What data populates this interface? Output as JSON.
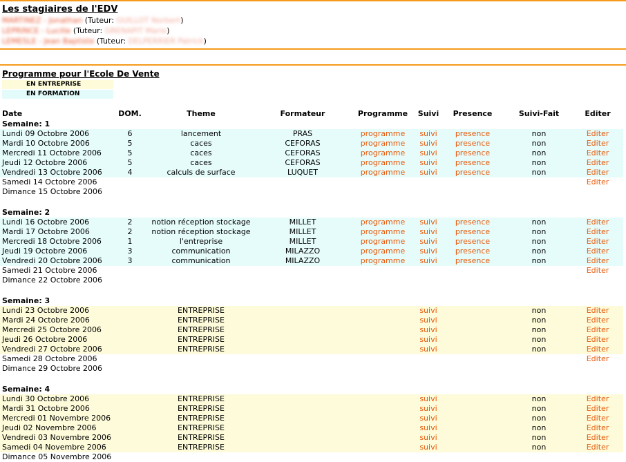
{
  "title": "Les stagiaires de l'EDV",
  "trainees": [
    {
      "name": "MARTINEZ - Jonathan",
      "tutor_label": "(Tuteur:",
      "tutor": "GUILLOT Norbert",
      "close": ")"
    },
    {
      "name": "LEPRINCE - Lucille",
      "tutor_label": "(Tuteur:",
      "tutor": "GRENAPIT Marie",
      "close": ")"
    },
    {
      "name": "LEMESLE - Jean Baptiste",
      "tutor_label": "(Tuteur:",
      "tutor": "DELPERRIER Patrick",
      "close": ")"
    }
  ],
  "programme_title": "Programme pour l'Ecole De Vente",
  "legend": {
    "entreprise": "EN ENTREPRISE",
    "formation": "EN FORMATION"
  },
  "columns": {
    "date": "Date",
    "dom": "DOM.",
    "theme": "Theme",
    "formateur": "Formateur",
    "programme": "Programme",
    "suivi": "Suivi",
    "presence": "Presence",
    "suivi_fait": "Suivi-Fait",
    "editer": "Editer"
  },
  "weeks": [
    {
      "label": "Semaine: 1",
      "days": [
        {
          "date": "Lundi 09 Octobre 2006",
          "type": "form",
          "dom": "6",
          "theme": "lancement",
          "formateur": "PRAS",
          "programme": "programme",
          "suivi": "suivi",
          "presence": "presence",
          "suivi_fait": "non",
          "editer": "Editer"
        },
        {
          "date": "Mardi 10 Octobre 2006",
          "type": "form",
          "dom": "5",
          "theme": "caces",
          "formateur": "CEFORAS",
          "programme": "programme",
          "suivi": "suivi",
          "presence": "presence",
          "suivi_fait": "non",
          "editer": "Editer"
        },
        {
          "date": "Mercredi 11 Octobre 2006",
          "type": "form",
          "dom": "5",
          "theme": "caces",
          "formateur": "CEFORAS",
          "programme": "programme",
          "suivi": "suivi",
          "presence": "presence",
          "suivi_fait": "non",
          "editer": "Editer"
        },
        {
          "date": "Jeudi 12 Octobre 2006",
          "type": "form",
          "dom": "5",
          "theme": "caces",
          "formateur": "CEFORAS",
          "programme": "programme",
          "suivi": "suivi",
          "presence": "presence",
          "suivi_fait": "non",
          "editer": "Editer"
        },
        {
          "date": "Vendredi 13 Octobre 2006",
          "type": "form",
          "dom": "4",
          "theme": "calculs de surface",
          "formateur": "LUQUET",
          "programme": "programme",
          "suivi": "suivi",
          "presence": "presence",
          "suivi_fait": "non",
          "editer": "Editer"
        },
        {
          "date": "Samedi 14 Octobre 2006",
          "type": "none",
          "editer": "Editer"
        },
        {
          "date": "Dimance 15 Octobre 2006",
          "type": "none"
        }
      ]
    },
    {
      "label": "Semaine: 2",
      "days": [
        {
          "date": "Lundi 16 Octobre 2006",
          "type": "form",
          "dom": "2",
          "theme": "notion réception stockage",
          "formateur": "MILLET",
          "programme": "programme",
          "suivi": "suivi",
          "presence": "presence",
          "suivi_fait": "non",
          "editer": "Editer"
        },
        {
          "date": "Mardi 17 Octobre 2006",
          "type": "form",
          "dom": "2",
          "theme": "notion réception stockage",
          "formateur": "MILLET",
          "programme": "programme",
          "suivi": "suivi",
          "presence": "presence",
          "suivi_fait": "non",
          "editer": "Editer"
        },
        {
          "date": "Mercredi 18 Octobre 2006",
          "type": "form",
          "dom": "1",
          "theme": "l'entreprise",
          "formateur": "MILLET",
          "programme": "programme",
          "suivi": "suivi",
          "presence": "presence",
          "suivi_fait": "non",
          "editer": "Editer"
        },
        {
          "date": "Jeudi 19 Octobre 2006",
          "type": "form",
          "dom": "3",
          "theme": "communication",
          "formateur": "MILAZZO",
          "programme": "programme",
          "suivi": "suivi",
          "presence": "presence",
          "suivi_fait": "non",
          "editer": "Editer"
        },
        {
          "date": "Vendredi 20 Octobre 2006",
          "type": "form",
          "dom": "3",
          "theme": "communication",
          "formateur": "MILAZZO",
          "programme": "programme",
          "suivi": "suivi",
          "presence": "presence",
          "suivi_fait": "non",
          "editer": "Editer"
        },
        {
          "date": "Samedi 21 Octobre 2006",
          "type": "none",
          "editer": "Editer"
        },
        {
          "date": "Dimance 22 Octobre 2006",
          "type": "none"
        }
      ]
    },
    {
      "label": "Semaine: 3",
      "days": [
        {
          "date": "Lundi 23 Octobre 2006",
          "type": "ent",
          "theme": "ENTREPRISE",
          "suivi": "suivi",
          "suivi_fait": "non",
          "editer": "Editer"
        },
        {
          "date": "Mardi 24 Octobre 2006",
          "type": "ent",
          "theme": "ENTREPRISE",
          "suivi": "suivi",
          "suivi_fait": "non",
          "editer": "Editer"
        },
        {
          "date": "Mercredi 25 Octobre 2006",
          "type": "ent",
          "theme": "ENTREPRISE",
          "suivi": "suivi",
          "suivi_fait": "non",
          "editer": "Editer"
        },
        {
          "date": "Jeudi 26 Octobre 2006",
          "type": "ent",
          "theme": "ENTREPRISE",
          "suivi": "suivi",
          "suivi_fait": "non",
          "editer": "Editer"
        },
        {
          "date": "Vendredi 27 Octobre 2006",
          "type": "ent",
          "theme": "ENTREPRISE",
          "suivi": "suivi",
          "suivi_fait": "non",
          "editer": "Editer"
        },
        {
          "date": "Samedi 28 Octobre 2006",
          "type": "none",
          "editer": "Editer"
        },
        {
          "date": "Dimance 29 Octobre 2006",
          "type": "none"
        }
      ]
    },
    {
      "label": "Semaine: 4",
      "days": [
        {
          "date": "Lundi 30 Octobre 2006",
          "type": "ent",
          "theme": "ENTREPRISE",
          "suivi": "suivi",
          "suivi_fait": "non",
          "editer": "Editer"
        },
        {
          "date": "Mardi 31 Octobre 2006",
          "type": "ent",
          "theme": "ENTREPRISE",
          "suivi": "suivi",
          "suivi_fait": "non",
          "editer": "Editer"
        },
        {
          "date": "Mercredi 01 Novembre 2006",
          "type": "ent",
          "theme": "ENTREPRISE",
          "suivi": "suivi",
          "suivi_fait": "non",
          "editer": "Editer"
        },
        {
          "date": "Jeudi 02 Novembre 2006",
          "type": "ent",
          "theme": "ENTREPRISE",
          "suivi": "suivi",
          "suivi_fait": "non",
          "editer": "Editer"
        },
        {
          "date": "Vendredi 03 Novembre 2006",
          "type": "ent",
          "theme": "ENTREPRISE",
          "suivi": "suivi",
          "suivi_fait": "non",
          "editer": "Editer"
        },
        {
          "date": "Samedi 04 Novembre 2006",
          "type": "ent",
          "theme": "ENTREPRISE",
          "suivi": "suivi",
          "suivi_fait": "non",
          "editer": "Editer"
        },
        {
          "date": "Dimance 05 Novembre 2006",
          "type": "none"
        }
      ]
    }
  ]
}
